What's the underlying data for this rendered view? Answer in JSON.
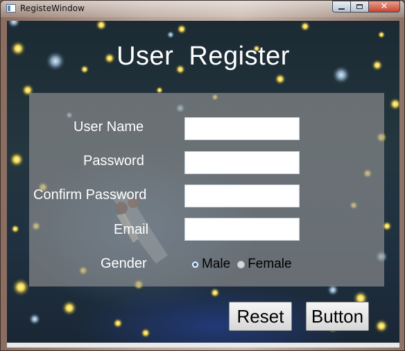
{
  "window": {
    "title": "RegisteWindow",
    "controls": {
      "minimize_icon": "minimize-icon",
      "maximize_icon": "maximize-icon",
      "close_glyph": "✕"
    }
  },
  "page": {
    "title": "User  Register"
  },
  "form": {
    "username_label": "User Name",
    "username_value": "",
    "password_label": "Password",
    "password_value": "",
    "confirm_label": "Confirm Password",
    "confirm_value": "",
    "email_label": "Email",
    "email_value": "",
    "gender_label": "Gender",
    "gender_options": [
      {
        "label": "Male",
        "selected": true
      },
      {
        "label": "Female",
        "selected": false
      }
    ]
  },
  "actions": {
    "reset_label": "Reset",
    "submit_label": "Button"
  },
  "colors": {
    "panel": "#969696",
    "title_text": "#ffffff",
    "background_night": "#1f3040",
    "radio_selected": "#2e64a8",
    "close_button": "#c7442e"
  }
}
